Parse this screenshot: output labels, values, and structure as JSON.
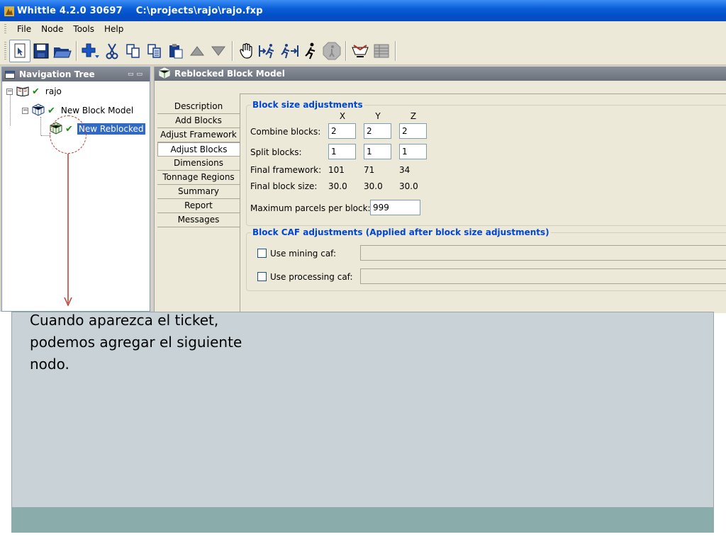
{
  "window": {
    "title": "Whittle 4.2.0 30697    C:\\projects\\rajo\\rajo.fxp"
  },
  "menu": [
    "File",
    "Node",
    "Tools",
    "Help"
  ],
  "toolbar": {
    "icons": [
      "select-icon",
      "save-icon",
      "open-folder-icon",
      "add-node-icon",
      "cut-icon",
      "copy-icon",
      "copy-data-icon",
      "paste-icon",
      "move-up-icon",
      "move-down-icon",
      "hand-icon",
      "run-to-icon",
      "run-from-icon",
      "run-icon",
      "stop-icon",
      "reports-icon",
      "table-icon"
    ]
  },
  "nav": {
    "title": "Navigation Tree",
    "tree": [
      {
        "label": "rajo",
        "level": 0
      },
      {
        "label": "New Block Model",
        "level": 1
      },
      {
        "label": "New Reblocked",
        "level": 2,
        "selected": true
      }
    ]
  },
  "panel": {
    "title": "Reblocked Block Model",
    "tabs": [
      "Description",
      "Add Blocks",
      "Adjust Framework",
      "Adjust Blocks",
      "Dimensions",
      "Tonnage Regions",
      "Summary",
      "Report",
      "Messages"
    ],
    "active_tab": "Adjust Blocks"
  },
  "block_size": {
    "legend": "Block size adjustments",
    "col_headers": [
      "X",
      "Y",
      "Z"
    ],
    "combine_label": "Combine blocks:",
    "combine": [
      "2",
      "2",
      "2"
    ],
    "split_label": "Split blocks:",
    "split": [
      "1",
      "1",
      "1"
    ],
    "framework_label": "Final framework:",
    "framework": [
      "101",
      "71",
      "34"
    ],
    "block_size_label": "Final block size:",
    "block_size": [
      "30.0",
      "30.0",
      "30.0"
    ],
    "max_parcels_label": "Maximum parcels per block:",
    "max_parcels": "999"
  },
  "block_caf": {
    "legend": "Block CAF adjustments (Applied after block size adjustments)",
    "mining_label": "Use mining caf:",
    "processing_label": "Use processing caf:"
  },
  "slide": {
    "caption": "Cuando aparezca el ticket, podemos agregar el siguiente nodo.",
    "accent": "#c0392b"
  }
}
